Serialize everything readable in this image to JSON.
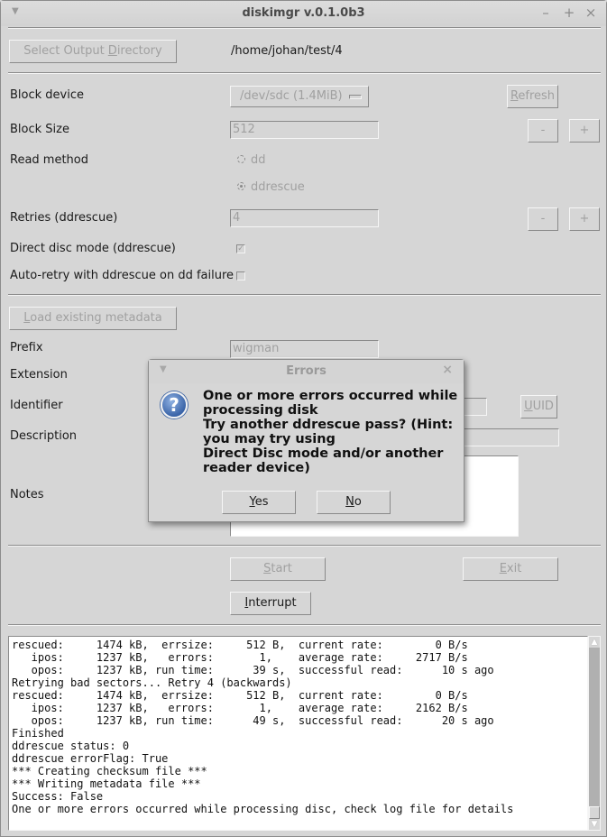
{
  "window": {
    "title": "diskimgr v.0.1.0b3",
    "controls": {
      "minimize": "–",
      "maximize": "+",
      "close": "×"
    },
    "menu_arrow": "▼"
  },
  "output": {
    "select_dir_label_pre": "Select Output ",
    "select_dir_label_mnemonic": "D",
    "select_dir_label_post": "irectory",
    "path": "/home/johan/test/4"
  },
  "device": {
    "block_device_label": "Block device",
    "block_device_value": "/dev/sdc (1.4MiB)",
    "refresh_mnemonic": "R",
    "refresh_rest": "efresh",
    "block_size_label": "Block Size",
    "block_size_value": "512",
    "read_method_label": "Read method",
    "read_methods": [
      {
        "label": "dd",
        "selected": false
      },
      {
        "label": "ddrescue",
        "selected": true
      }
    ],
    "retries_label": "Retries (ddrescue)",
    "retries_value": "4",
    "minus": "-",
    "plus": "+",
    "direct_disc_label": "Direct disc mode (ddrescue)",
    "direct_disc_checked": true,
    "check_mark": "✓",
    "auto_retry_label": "Auto-retry with ddrescue on dd failure",
    "auto_retry_checked": false
  },
  "metadata": {
    "load_mnemonic": "L",
    "load_rest": "oad existing metadata",
    "prefix_label": "Prefix",
    "prefix_value": "wigman",
    "extension_label": "Extension",
    "identifier_label": "Identifier",
    "uuid_mnemonic": "U",
    "uuid_rest": "UID",
    "description_label": "Description",
    "notes_label": "Notes"
  },
  "actions": {
    "start_mnemonic": "S",
    "start_rest": "tart",
    "exit_mnemonic": "E",
    "exit_rest": "xit",
    "interrupt_mnemonic": "I",
    "interrupt_rest": "nterrupt"
  },
  "log": {
    "lines": [
      "rescued:     1474 kB,  errsize:     512 B,  current rate:        0 B/s",
      "   ipos:     1237 kB,   errors:       1,    average rate:     2717 B/s",
      "   opos:     1237 kB, run time:      39 s,  successful read:      10 s ago",
      "Retrying bad sectors... Retry 4 (backwards)",
      "rescued:     1474 kB,  errsize:     512 B,  current rate:        0 B/s",
      "   ipos:     1237 kB,   errors:       1,    average rate:     2162 B/s",
      "   opos:     1237 kB, run time:      49 s,  successful read:      20 s ago",
      "Finished",
      "ddrescue status: 0",
      "ddrescue errorFlag: True",
      "*** Creating checksum file ***",
      "*** Writing metadata file ***",
      "Success: False",
      "One or more errors occurred while processing disc, check log file for details"
    ],
    "scroll_up": "▲",
    "scroll_down": "▼"
  },
  "dialog": {
    "title": "Errors",
    "close": "×",
    "icon": "?",
    "message_lines": [
      "One or more errors occurred while",
      "processing disk",
      "Try another ddrescue pass? (Hint:",
      "you may try using",
      "Direct Disc mode and/or another",
      "reader device)"
    ],
    "yes_mnemonic": "Y",
    "yes_rest": "es",
    "no_mnemonic": "N",
    "no_rest": "o"
  }
}
